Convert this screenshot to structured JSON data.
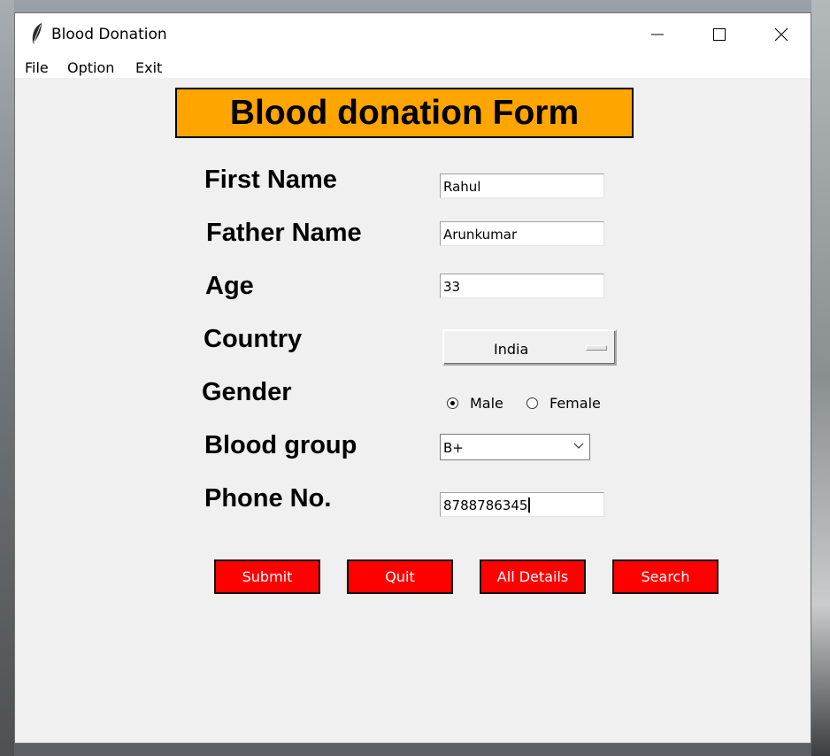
{
  "window": {
    "title": "Blood Donation"
  },
  "menu": {
    "items": [
      "File",
      "Option",
      "Exit"
    ]
  },
  "form": {
    "title": "Blood donation Form",
    "labels": {
      "first_name": "First Name",
      "father_name": "Father Name",
      "age": "Age",
      "country": "Country",
      "gender": "Gender",
      "blood_group": "Blood group",
      "phone": "Phone No."
    },
    "values": {
      "first_name": "Rahul",
      "father_name": "Arunkumar",
      "age": "33",
      "country": "India",
      "blood_group": "B+",
      "phone": "8788786345"
    },
    "gender_options": {
      "male": "Male",
      "female": "Female"
    },
    "gender_selected": "Male",
    "buttons": {
      "submit": "Submit",
      "quit": "Quit",
      "all_details": "All Details",
      "search": "Search"
    }
  },
  "colors": {
    "title_bg": "#ffa500",
    "button_bg": "#ff0000",
    "button_text": "#ffffff",
    "window_bg": "#f0f0f0"
  },
  "icons": [
    "feather-icon",
    "minimize-icon",
    "maximize-icon",
    "close-icon",
    "chevron-down-icon"
  ]
}
